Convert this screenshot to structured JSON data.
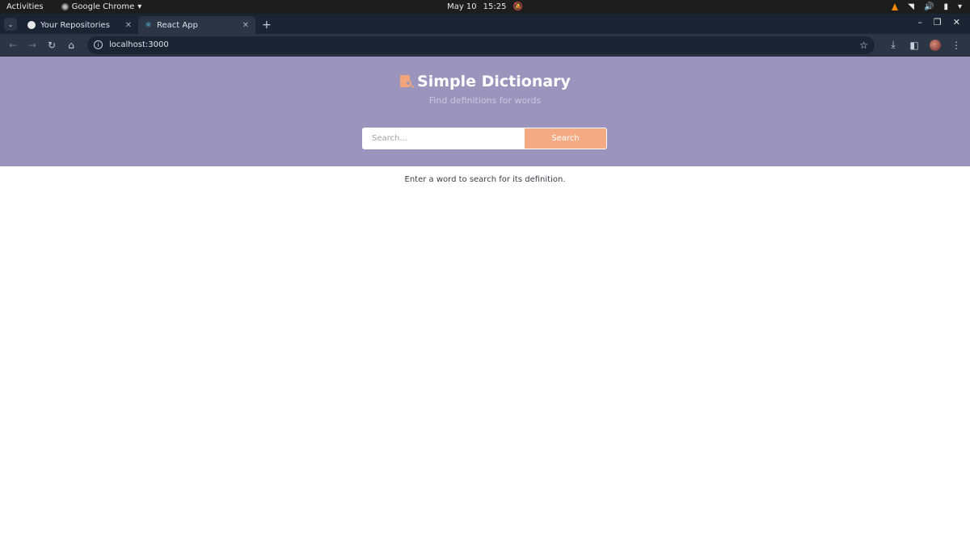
{
  "system_bar": {
    "activities": "Activities",
    "app_name": "Google Chrome",
    "date": "May 10",
    "time": "15:25"
  },
  "browser": {
    "tabs": [
      {
        "title": "Your Repositories",
        "active": false,
        "icon": "github-icon"
      },
      {
        "title": "React App",
        "active": true,
        "icon": "react-icon"
      }
    ],
    "url": "localhost:3000"
  },
  "app": {
    "title": "Simple Dictionary",
    "subtitle": "Find definitions for words",
    "search": {
      "placeholder": "Search...",
      "value": "",
      "button_label": "Search"
    },
    "hint": "Enter a word to search for its definition.",
    "colors": {
      "header_bg": "#9b94bd",
      "accent": "#f4aa82"
    }
  }
}
